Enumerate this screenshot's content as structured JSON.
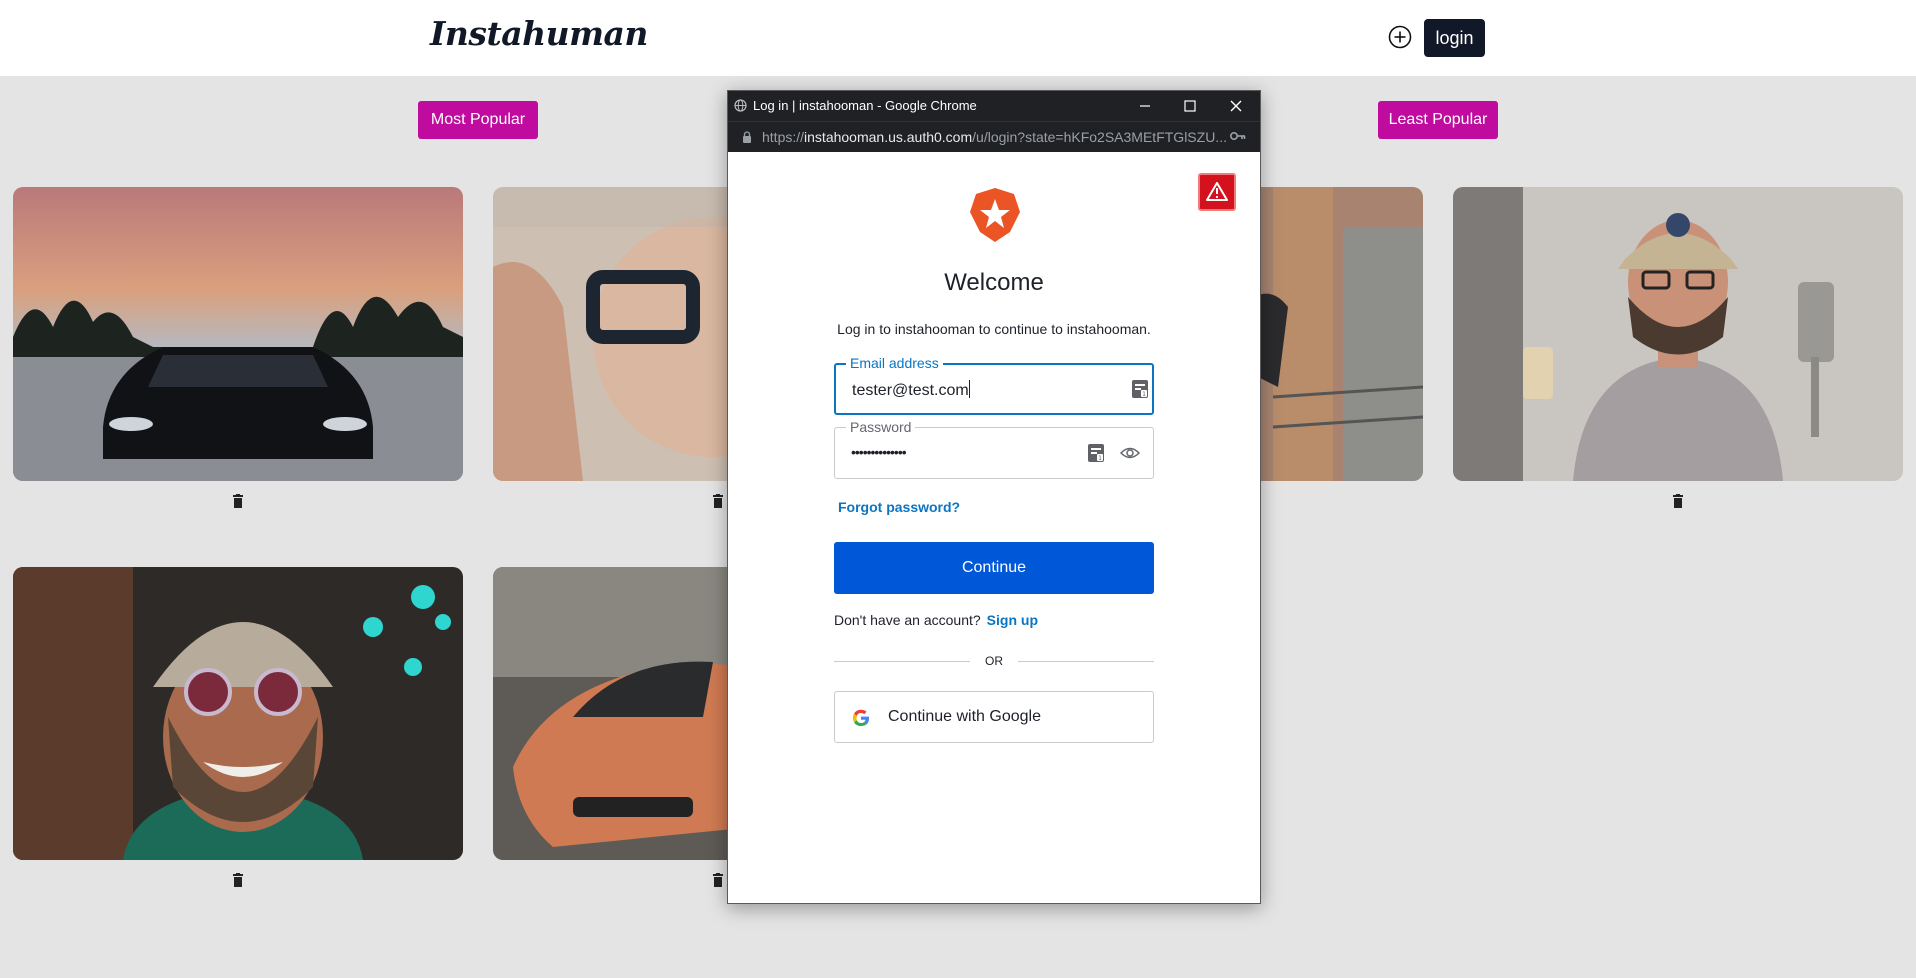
{
  "header": {
    "brand": "Instahuman",
    "login_label": "login"
  },
  "filters": {
    "most_popular": "Most Popular",
    "least_popular": "Least Popular"
  },
  "photos": [
    {
      "subject": "black sports sedan at sunset"
    },
    {
      "subject": "man holding eyeglasses"
    },
    {
      "subject": "man leaning on balcony railing"
    },
    {
      "subject": "bearded man with cap holding spatula"
    },
    {
      "subject": "smiling man with beanie and goggles"
    },
    {
      "subject": "orange sports car"
    }
  ],
  "popup": {
    "window_title": "Log in | instahooman - Google Chrome",
    "url_scheme": "https://",
    "url_host": "instahooman.us.auth0.com",
    "url_path": "/u/login?state=hKFo2SA3MEtFTGlSZU...",
    "welcome": "Welcome",
    "subtitle": "Log in to instahooman to continue to instahooman.",
    "email_label": "Email address",
    "email_value": "tester@test.com",
    "password_label": "Password",
    "password_value": "••••••••••••••",
    "forgot": "Forgot password?",
    "continue": "Continue",
    "no_account": "Don't have an account?",
    "sign_up": "Sign up",
    "or": "OR",
    "google": "Continue with Google"
  },
  "colors": {
    "pill": "#c00c9e",
    "primary": "#0057d8",
    "link": "#0a75c2",
    "warning": "#d4121e"
  }
}
